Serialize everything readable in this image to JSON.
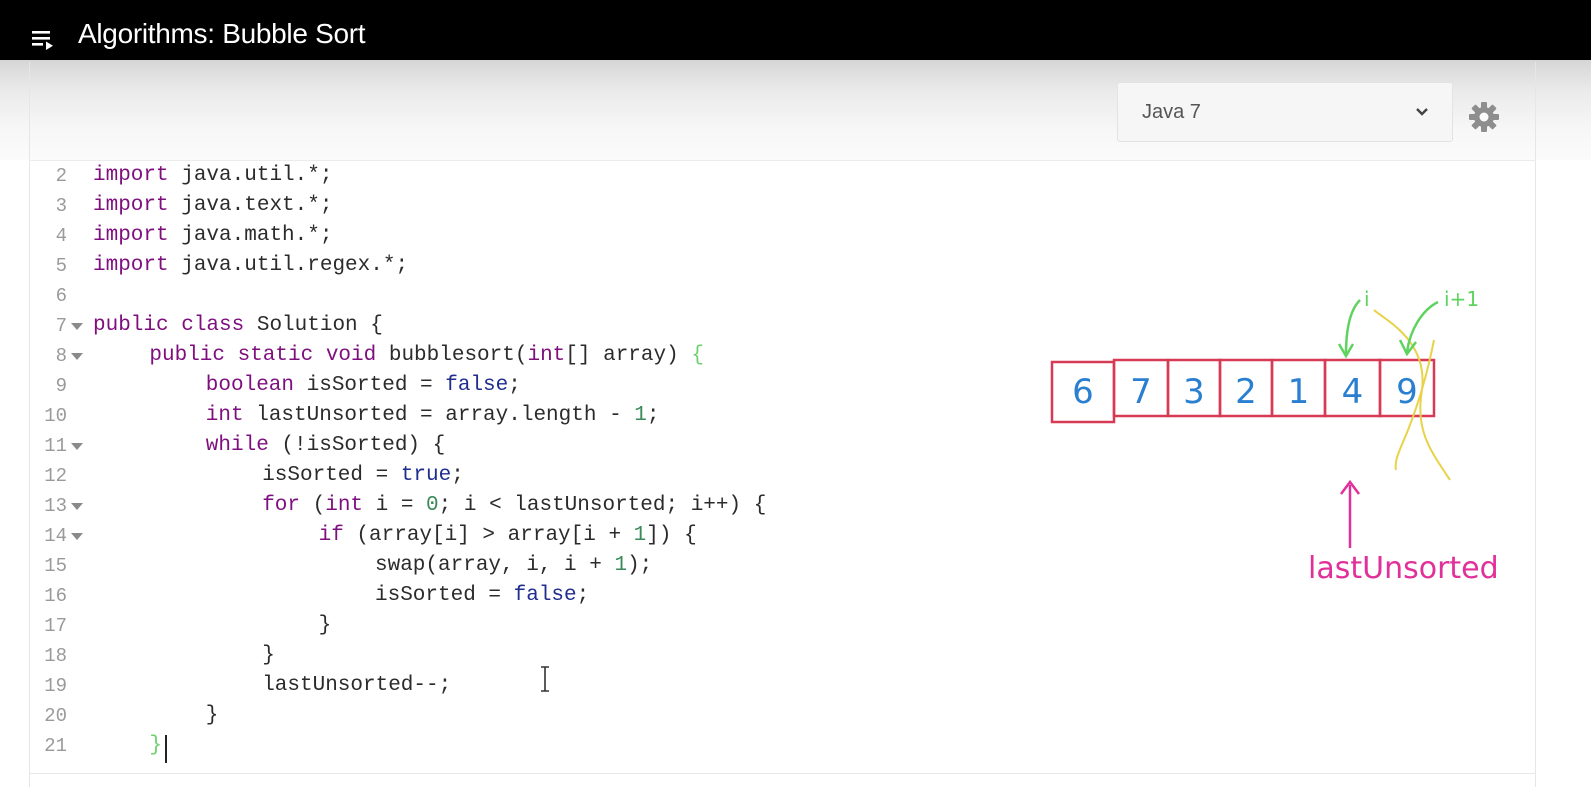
{
  "header": {
    "title": "Algorithms: Bubble Sort",
    "playlist_icon": "playlist-icon"
  },
  "toolbar": {
    "language": "Java 7",
    "dropdown_icon": "chevron-down-icon",
    "settings_icon": "gear-icon"
  },
  "editor": {
    "lines": [
      {
        "n": "2",
        "fold": false,
        "indent": 0,
        "tokens": [
          [
            "kw",
            "import"
          ],
          [
            "t",
            " java.util.*;"
          ]
        ]
      },
      {
        "n": "3",
        "fold": false,
        "indent": 0,
        "tokens": [
          [
            "kw",
            "import"
          ],
          [
            "t",
            " java.text.*;"
          ]
        ]
      },
      {
        "n": "4",
        "fold": false,
        "indent": 0,
        "tokens": [
          [
            "kw",
            "import"
          ],
          [
            "t",
            " java.math.*;"
          ]
        ]
      },
      {
        "n": "5",
        "fold": false,
        "indent": 0,
        "tokens": [
          [
            "kw",
            "import"
          ],
          [
            "t",
            " java.util.regex.*;"
          ]
        ]
      },
      {
        "n": "6",
        "fold": false,
        "indent": 0,
        "tokens": []
      },
      {
        "n": "7",
        "fold": true,
        "indent": 0,
        "tokens": [
          [
            "kw",
            "public class"
          ],
          [
            "t",
            " Solution {"
          ]
        ]
      },
      {
        "n": "8",
        "fold": true,
        "indent": 4,
        "tokens": [
          [
            "kw",
            "public static void"
          ],
          [
            "t",
            " bubblesort("
          ],
          [
            "kw",
            "int"
          ],
          [
            "t",
            "[] array) "
          ],
          [
            "hl",
            "{"
          ]
        ]
      },
      {
        "n": "9",
        "fold": false,
        "indent": 8,
        "tokens": [
          [
            "kw",
            "boolean"
          ],
          [
            "t",
            " isSorted = "
          ],
          [
            "lit",
            "false"
          ],
          [
            "t",
            ";"
          ]
        ]
      },
      {
        "n": "10",
        "fold": false,
        "indent": 8,
        "tokens": [
          [
            "kw",
            "int"
          ],
          [
            "t",
            " lastUnsorted = array.length - "
          ],
          [
            "num",
            "1"
          ],
          [
            "t",
            ";"
          ]
        ]
      },
      {
        "n": "11",
        "fold": true,
        "indent": 8,
        "tokens": [
          [
            "kw",
            "while"
          ],
          [
            "t",
            " (!isSorted) {"
          ]
        ]
      },
      {
        "n": "12",
        "fold": false,
        "indent": 12,
        "tokens": [
          [
            "t",
            "isSorted = "
          ],
          [
            "lit",
            "true"
          ],
          [
            "t",
            ";"
          ]
        ]
      },
      {
        "n": "13",
        "fold": true,
        "indent": 12,
        "tokens": [
          [
            "kw",
            "for"
          ],
          [
            "t",
            " ("
          ],
          [
            "kw",
            "int"
          ],
          [
            "t",
            " i = "
          ],
          [
            "num",
            "0"
          ],
          [
            "t",
            "; i < lastUnsorted; i++) {"
          ]
        ]
      },
      {
        "n": "14",
        "fold": true,
        "indent": 16,
        "tokens": [
          [
            "kw",
            "if"
          ],
          [
            "t",
            " (array[i] > array[i + "
          ],
          [
            "num",
            "1"
          ],
          [
            "t",
            "]) {"
          ]
        ]
      },
      {
        "n": "15",
        "fold": false,
        "indent": 20,
        "tokens": [
          [
            "t",
            "swap(array, i, i + "
          ],
          [
            "num",
            "1"
          ],
          [
            "t",
            ");"
          ]
        ]
      },
      {
        "n": "16",
        "fold": false,
        "indent": 20,
        "tokens": [
          [
            "t",
            "isSorted = "
          ],
          [
            "lit",
            "false"
          ],
          [
            "t",
            ";"
          ]
        ]
      },
      {
        "n": "17",
        "fold": false,
        "indent": 16,
        "tokens": [
          [
            "t",
            "}"
          ]
        ]
      },
      {
        "n": "18",
        "fold": false,
        "indent": 12,
        "tokens": [
          [
            "t",
            "}"
          ]
        ]
      },
      {
        "n": "19",
        "fold": false,
        "indent": 12,
        "tokens": [
          [
            "t",
            "lastUnsorted--;"
          ]
        ]
      },
      {
        "n": "20",
        "fold": false,
        "indent": 8,
        "tokens": [
          [
            "t",
            "}"
          ]
        ]
      },
      {
        "n": "21",
        "fold": false,
        "indent": 4,
        "tokens": [
          [
            "hl",
            "}"
          ]
        ]
      }
    ]
  },
  "drawing": {
    "array_values": [
      "6",
      "7",
      "3",
      "2",
      "1",
      "4",
      "9"
    ],
    "label_i": "i",
    "label_i_plus_1": "i+1",
    "label_last": "lastUnsorted",
    "colors": {
      "box": "#d63a55",
      "digits": "#2a7fd0",
      "arrows": "#5fd35f",
      "cross": "#e8d24a",
      "pointer": "#e0309a"
    }
  }
}
